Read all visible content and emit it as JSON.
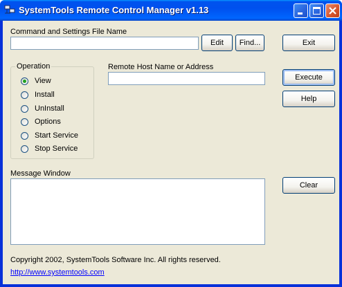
{
  "window": {
    "title": "SystemTools Remote Control Manager v1.13"
  },
  "settings_file": {
    "label": "Command and Settings File Name",
    "value": ""
  },
  "buttons": {
    "edit": "Edit",
    "find": "Find...",
    "exit": "Exit",
    "execute": "Execute",
    "help": "Help",
    "clear": "Clear"
  },
  "operation": {
    "legend": "Operation",
    "options": [
      {
        "label": "View",
        "selected": true
      },
      {
        "label": "Install",
        "selected": false
      },
      {
        "label": "UnInstall",
        "selected": false
      },
      {
        "label": "Options",
        "selected": false
      },
      {
        "label": "Start Service",
        "selected": false
      },
      {
        "label": "Stop Service",
        "selected": false
      }
    ]
  },
  "remote_host": {
    "label": "Remote Host Name or Address",
    "value": ""
  },
  "message_window": {
    "label": "Message Window",
    "value": ""
  },
  "footer": {
    "copyright": "Copyright 2002, SystemTools Software Inc.  All rights reserved.",
    "link": "http://www.systemtools.com"
  },
  "colors": {
    "title_bar": "#0053ee",
    "dialog_bg": "#ece9d8",
    "radio_selected": "#21a121",
    "link": "#0000ff"
  },
  "icons": {
    "app": "network-computers-icon",
    "minimize": "minimize-icon",
    "maximize": "maximize-icon",
    "close": "close-icon"
  }
}
